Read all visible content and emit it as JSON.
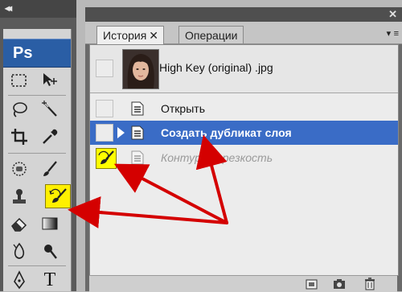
{
  "tools_panel": {
    "logo": "Ps",
    "tools": [
      {
        "name": "rectangular-marquee-icon"
      },
      {
        "name": "move-icon"
      },
      {
        "name": "lasso-icon"
      },
      {
        "name": "magic-wand-icon"
      },
      {
        "name": "crop-icon"
      },
      {
        "name": "eyedropper-icon"
      },
      {
        "name": "spot-healing-icon"
      },
      {
        "name": "brush-icon"
      },
      {
        "name": "clone-stamp-icon"
      },
      {
        "name": "history-brush-icon",
        "highlighted": true
      },
      {
        "name": "eraser-icon"
      },
      {
        "name": "gradient-icon"
      },
      {
        "name": "blur-icon"
      },
      {
        "name": "dodge-icon"
      },
      {
        "name": "pen-icon"
      },
      {
        "name": "type-icon",
        "label": "T"
      }
    ]
  },
  "history_panel": {
    "tabs": [
      {
        "label": "История",
        "active": true,
        "close": "✕"
      },
      {
        "label": "Операции",
        "active": false
      }
    ],
    "menu_icon": "panel-menu-icon",
    "snapshot": {
      "label": "High Key (original) .jpg"
    },
    "states": [
      {
        "label": "Открыть",
        "state": "normal"
      },
      {
        "label": "Создать дубликат слоя",
        "state": "selected"
      },
      {
        "label": "Контурная резкость",
        "state": "undone"
      }
    ],
    "footer_icons": [
      "new-document-from-state-icon",
      "new-snapshot-icon",
      "trash-icon"
    ]
  },
  "colors": {
    "selection": "#3a6cc6",
    "highlight": "#ffff00",
    "arrow": "#d40000",
    "ps_logo": "#2a5ea5"
  }
}
